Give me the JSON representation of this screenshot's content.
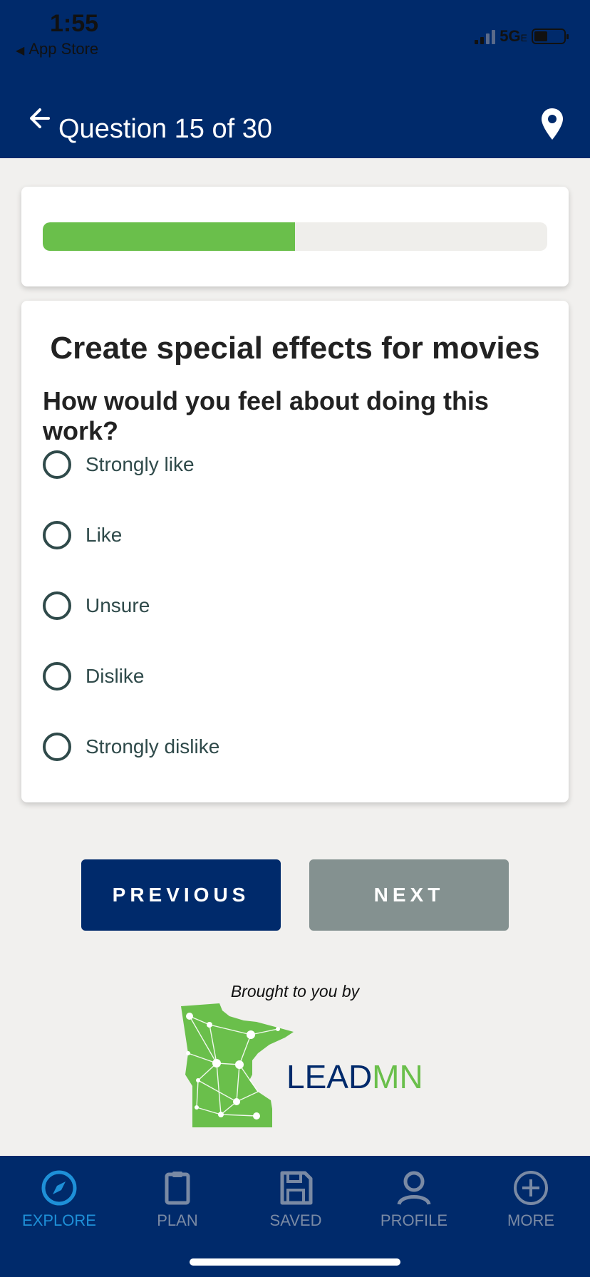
{
  "status_bar": {
    "time": "1:55",
    "back_app": "App Store",
    "network": "5G",
    "network_suffix": "E"
  },
  "header": {
    "title": "Question 15 of 30",
    "back_icon": "arrow-left-icon",
    "location_icon": "map-pin-icon"
  },
  "progress": {
    "fraction": 0.5,
    "fill_color": "#6abf4b"
  },
  "question": {
    "activity": "Create special effects for movies",
    "prompt": "How would you feel about doing this work?",
    "options": [
      {
        "label": "Strongly like"
      },
      {
        "label": "Like"
      },
      {
        "label": "Unsure"
      },
      {
        "label": "Dislike"
      },
      {
        "label": "Strongly dislike"
      }
    ]
  },
  "buttons": {
    "previous": "PREVIOUS",
    "next": "NEXT"
  },
  "sponsor": {
    "tagline": "Brought to you by",
    "logo_part1": "LEAD",
    "logo_part2": "MN"
  },
  "tabbar": {
    "items": [
      {
        "label": "EXPLORE",
        "icon": "compass-icon",
        "active": true
      },
      {
        "label": "PLAN",
        "icon": "clipboard-icon",
        "active": false
      },
      {
        "label": "SAVED",
        "icon": "floppy-disk-icon",
        "active": false
      },
      {
        "label": "PROFILE",
        "icon": "user-icon",
        "active": false
      },
      {
        "label": "MORE",
        "icon": "plus-circle-icon",
        "active": false
      }
    ]
  },
  "colors": {
    "brand_navy": "#002a6b",
    "accent_green": "#6abf4b",
    "disabled_gray": "#849190",
    "tab_active": "#1e90d8"
  }
}
